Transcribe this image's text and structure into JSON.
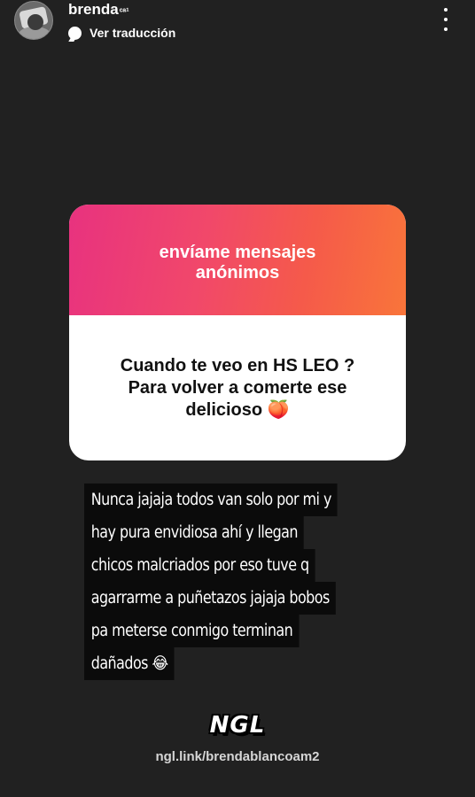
{
  "header": {
    "username": "brenda",
    "username_suffix": "ᶜᵃ¹",
    "translate_label": "Ver traducción",
    "icons": [
      "avatar",
      "translate-icon",
      "more-vertical-icon"
    ]
  },
  "card": {
    "title": "envíame mensajes\nanónimos",
    "question": "Cuando te veo en HS LEO ?\nPara volver a comerte ese\ndelicioso 🍑",
    "gradient": [
      "#e8327f",
      "#f9753a"
    ]
  },
  "reply": {
    "lines": [
      "Nunca jajaja todos van solo por mi y",
      "hay pura envidiosa ahí y llegan",
      "chicos malcriados por eso tuve q",
      "agarrarme a puñetazos jajaja bobos",
      "pa meterse conmigo terminan",
      "dañados 😂"
    ]
  },
  "footer": {
    "logo": "NGL",
    "link": "ngl.link/brendablancoam2"
  },
  "colors": {
    "background": "#212121",
    "reply_bg": "#0b0b0b"
  }
}
